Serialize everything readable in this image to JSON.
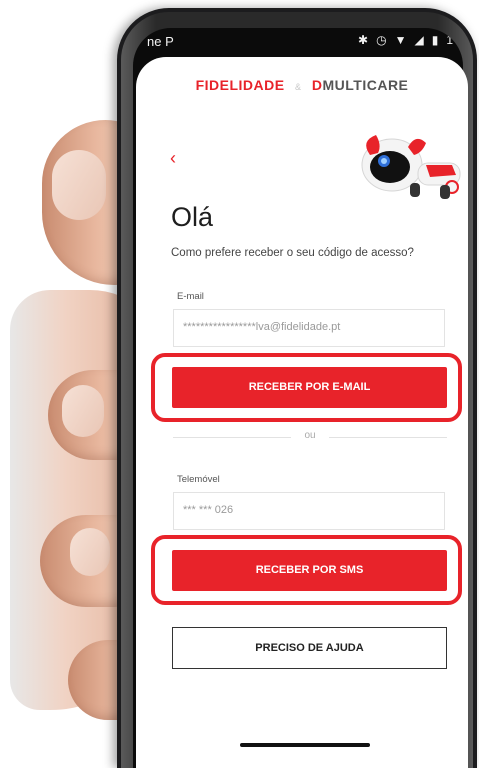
{
  "status_bar": {
    "carrier": "ne P",
    "icons": [
      "bluetooth-icon",
      "alarm-icon",
      "wifi-icon",
      "signal-icon",
      "battery-icon"
    ],
    "battery_text": "1"
  },
  "brand": {
    "left": "FIDELIDADE",
    "amp": "&",
    "right_prefix": "D",
    "right": "MULTICARE",
    "accent_color": "#e8232a"
  },
  "header": {
    "back_icon": "chevron-left-icon"
  },
  "main": {
    "title": "Olá",
    "subtitle": "Como prefere receber o seu código de acesso?",
    "email": {
      "label": "E-mail",
      "value": "*****************lva@fidelidade.pt",
      "button": "RECEBER POR E-MAIL"
    },
    "divider_text": "ou",
    "phone": {
      "label": "Telemóvel",
      "value": "*** *** 026",
      "button": "RECEBER POR SMS"
    },
    "help_button": "PRECISO DE AJUDA"
  }
}
